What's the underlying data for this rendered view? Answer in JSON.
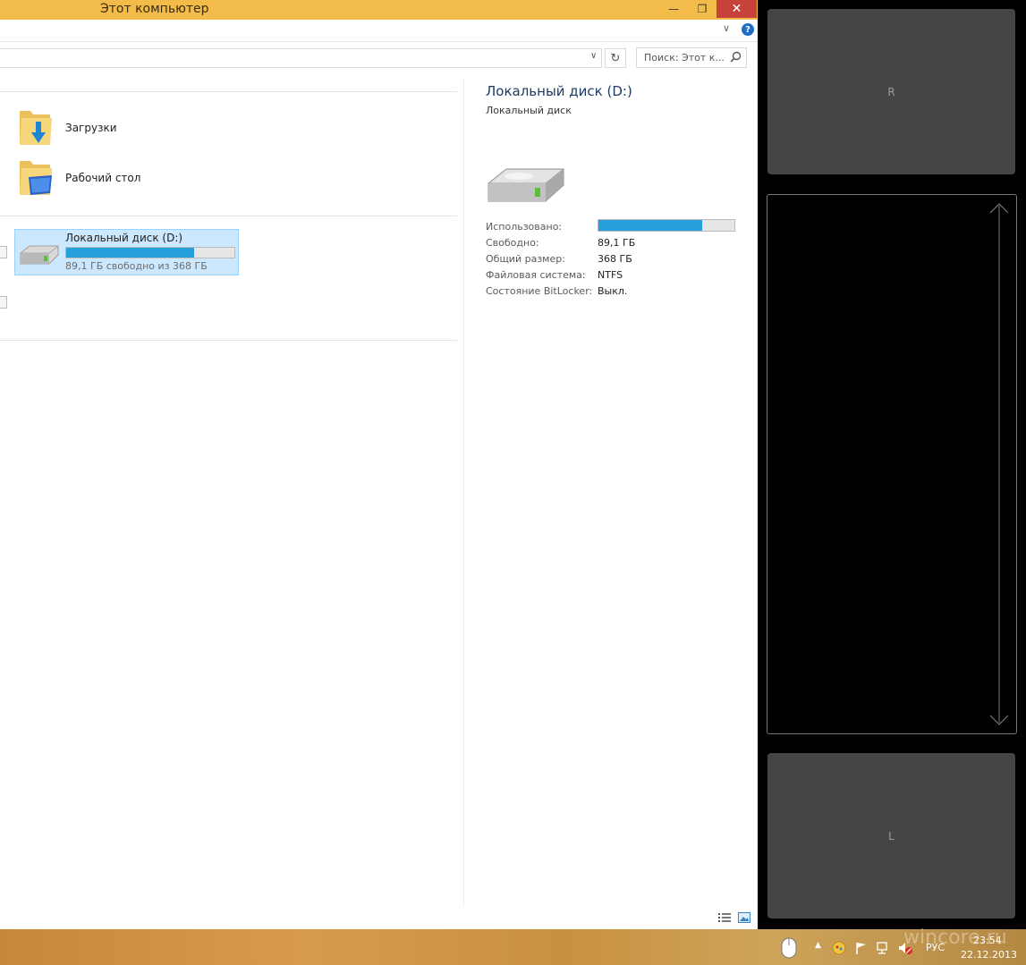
{
  "window": {
    "title": "Этот компьютер"
  },
  "search": {
    "placeholder": "Поиск: Этот к..."
  },
  "folders": [
    {
      "label": "Загрузки"
    },
    {
      "label": "Рабочий стол"
    }
  ],
  "drive": {
    "name": "Локальный диск (D:)",
    "free_text": "89,1 ГБ свободно из 368 ГБ",
    "used_fraction": 0.76
  },
  "details": {
    "title": "Локальный диск (D:)",
    "subtitle": "Локальный диск",
    "props": [
      {
        "label": "Использовано:",
        "value": ""
      },
      {
        "label": "Свободно:",
        "value": "89,1 ГБ"
      },
      {
        "label": "Общий размер:",
        "value": "368 ГБ"
      },
      {
        "label": "Файловая система:",
        "value": "NTFS"
      },
      {
        "label": "Состояние BitLocker:",
        "value": "Выкл."
      }
    ],
    "used_fraction": 0.76
  },
  "touch_panel": {
    "top_label": "R",
    "bottom_label": "L"
  },
  "taskbar": {
    "language": "РУС",
    "time": "23:54",
    "date": "22.12.2013",
    "watermark": "wincore.ru"
  },
  "colors": {
    "title_bar": "#f3bc4a",
    "accent_bar": "#26a0da",
    "selection": "#cce8ff"
  }
}
